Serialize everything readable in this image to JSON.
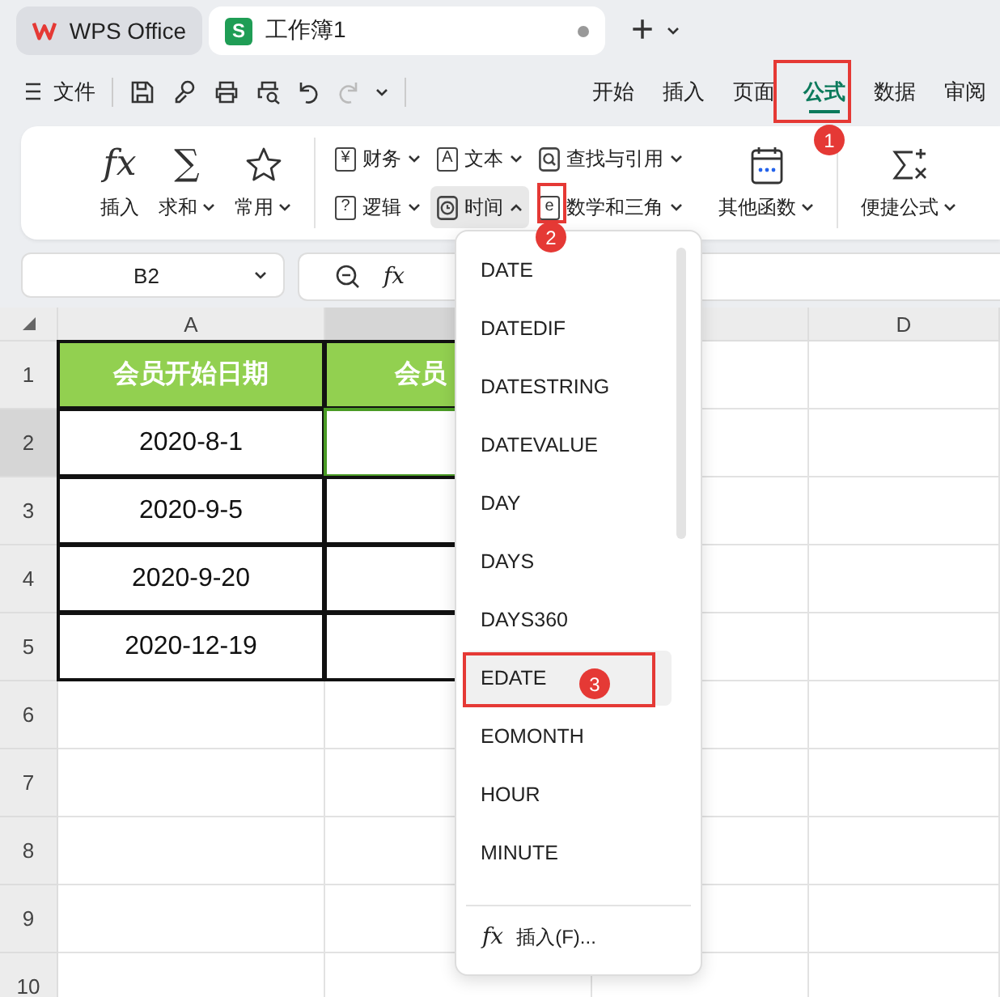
{
  "app_tabs": [
    {
      "kind": "home",
      "label": "WPS Office",
      "selected": false
    },
    {
      "kind": "sheet",
      "badge": "S",
      "label": "工作簿1",
      "selected": true
    }
  ],
  "new_tab": "+",
  "menu": {
    "label": "文件"
  },
  "ribbon_tabs": [
    {
      "label": "开始",
      "selected": false
    },
    {
      "label": "插入",
      "selected": false
    },
    {
      "label": "页面",
      "selected": false
    },
    {
      "label": "公式",
      "selected": true
    },
    {
      "label": "数据",
      "selected": false
    },
    {
      "label": "审阅",
      "selected": false
    }
  ],
  "ribbon": {
    "large": [
      {
        "kind": "glyph",
        "glyph": "fx",
        "label": "插入",
        "has_menu": false
      },
      {
        "kind": "glyph",
        "glyph": "∑",
        "label": "求和",
        "has_menu": true
      },
      {
        "kind": "star",
        "label": "常用",
        "has_menu": true
      }
    ],
    "categories": [
      {
        "kind": "glyph",
        "glyph": "¥",
        "label": "财务",
        "open": false
      },
      {
        "kind": "glyph",
        "glyph": "A",
        "label": "文本",
        "open": false
      },
      {
        "kind": "lookup",
        "label": "查找与引用",
        "open": false
      },
      {
        "kind": "glyph",
        "glyph": "?",
        "label": "逻辑",
        "open": false
      },
      {
        "kind": "clock",
        "label": "时间",
        "open": true
      },
      {
        "kind": "glyph",
        "glyph": "e",
        "label": "数学和三角",
        "open": false
      }
    ],
    "more": {
      "label": "其他函数"
    },
    "quick": {
      "label": "便捷公式"
    }
  },
  "formula_bar": {
    "name_box": "B2",
    "fx": "fx"
  },
  "sheet": {
    "columns": [
      {
        "label": "A",
        "selected": false
      },
      {
        "selected": true
      },
      {
        "selected": false
      },
      {
        "label": "D",
        "selected": false
      }
    ],
    "rows": [
      {
        "label": "1",
        "selected": false,
        "cells": [
          "会员开始日期",
          "会员"
        ]
      },
      {
        "label": "2",
        "selected": true,
        "cells": [
          "2020-8-1",
          ""
        ]
      },
      {
        "label": "3",
        "selected": false,
        "cells": [
          "2020-9-5",
          ""
        ]
      },
      {
        "label": "4",
        "selected": false,
        "cells": [
          "2020-9-20",
          ""
        ]
      },
      {
        "label": "5",
        "selected": false,
        "cells": [
          "2020-12-19",
          ""
        ]
      },
      {
        "label": "6",
        "selected": false,
        "cells": []
      },
      {
        "label": "7",
        "selected": false,
        "cells": []
      },
      {
        "label": "8",
        "selected": false,
        "cells": []
      },
      {
        "label": "9",
        "selected": false,
        "cells": []
      },
      {
        "label": "10",
        "selected": false,
        "cells": []
      }
    ]
  },
  "function_menu": {
    "items": [
      {
        "label": "DATE",
        "selected": false
      },
      {
        "label": "DATEDIF",
        "selected": false
      },
      {
        "label": "DATESTRING",
        "selected": false
      },
      {
        "label": "DATEVALUE",
        "selected": false
      },
      {
        "label": "DAY",
        "selected": false
      },
      {
        "label": "DAYS",
        "selected": false
      },
      {
        "label": "DAYS360",
        "selected": false
      },
      {
        "label": "EDATE",
        "selected": true
      },
      {
        "label": "EOMONTH",
        "selected": false
      },
      {
        "label": "HOUR",
        "selected": false
      },
      {
        "label": "MINUTE",
        "selected": false
      }
    ],
    "footer": {
      "glyph": "fx",
      "label": "插入(F)..."
    }
  },
  "annotations": [
    {
      "number": "1"
    },
    {
      "number": "2"
    },
    {
      "number": "3"
    }
  ]
}
